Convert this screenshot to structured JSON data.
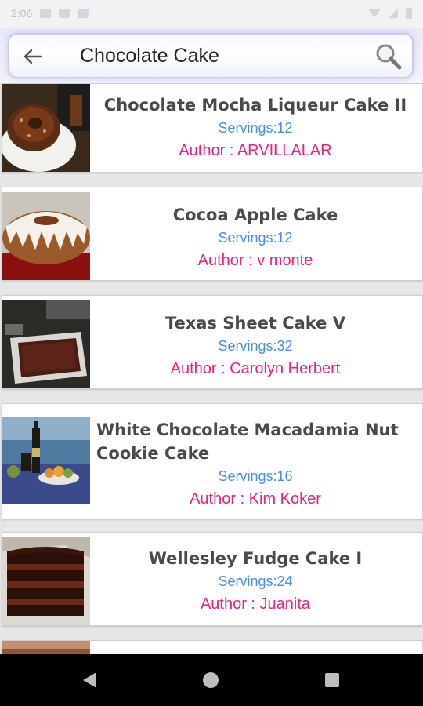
{
  "status_bar": {
    "time": "2:06"
  },
  "search": {
    "query": "Chocolate Cake"
  },
  "recipes": [
    {
      "title": "Chocolate Mocha Liqueur Cake II",
      "servings": "Servings:12",
      "author": "Author : ARVILLALAR",
      "image": "bundt-cake-chocolate"
    },
    {
      "title": "Cocoa Apple Cake",
      "servings": "Servings:12",
      "author": "Author : v monte",
      "image": "bundt-cake-glazed"
    },
    {
      "title": "Texas Sheet Cake V",
      "servings": "Servings:32",
      "author": "Author : Carolyn Herbert",
      "image": "sheet-cake-pan"
    },
    {
      "title": "White Chocolate Macadamia Nut Cookie Cake",
      "servings": "Servings:16",
      "author": "Author : Kim Koker",
      "image": "table-seaside"
    },
    {
      "title": "Wellesley Fudge Cake I",
      "servings": "Servings:24",
      "author": "Author : Juanita",
      "image": "layer-cake-slice"
    }
  ],
  "colors": {
    "title": "#4a4a4a",
    "servings": "#4a8fe0",
    "author": "#e8227d",
    "background": "#e6e6e6",
    "navbar": "#000000"
  },
  "icons": {
    "back": "arrow-left-icon",
    "search": "magnifier-icon",
    "nav_back": "triangle-back-icon",
    "nav_home": "circle-home-icon",
    "nav_recent": "square-recent-icon"
  }
}
